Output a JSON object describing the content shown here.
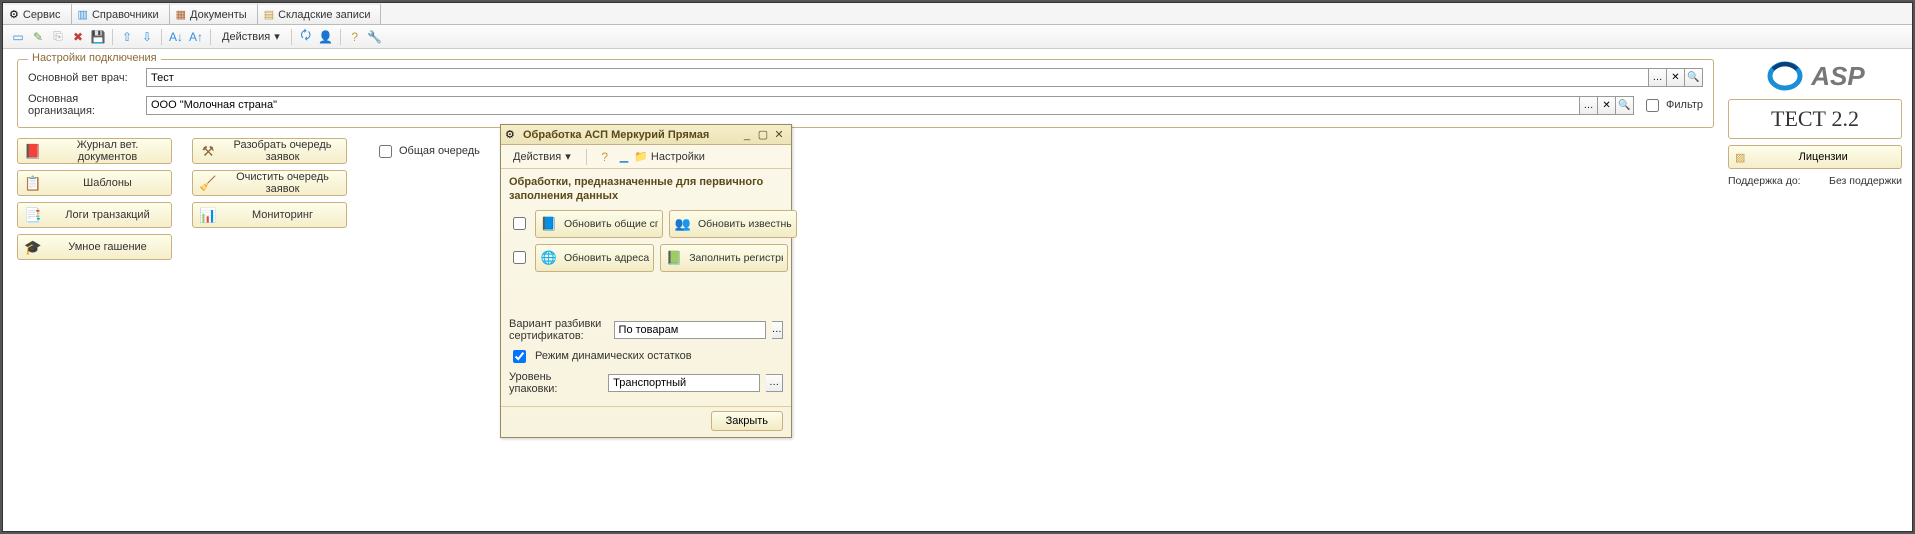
{
  "tabs": [
    {
      "label": "Сервис"
    },
    {
      "label": "Справочники"
    },
    {
      "label": "Документы"
    },
    {
      "label": "Складские записи"
    }
  ],
  "toolbar": {
    "actions": "Действия"
  },
  "connection": {
    "legend": "Настройки подключения",
    "vet_label": "Основной вет врач:",
    "vet_value": "Тест",
    "org_label": "Основная организация:",
    "org_value": "ООО \"Молочная страна\"",
    "filter_label": "Фильтр"
  },
  "buttons": {
    "journal": "Журнал вет. документов",
    "parse_queue": "Разобрать очередь заявок",
    "common_queue": "Общая очередь",
    "templates": "Шаблоны",
    "clear_queue": "Очистить очередь заявок",
    "trans_logs": "Логи транзакций",
    "monitoring": "Мониторинг",
    "smart_clear": "Умное гашение"
  },
  "dialog": {
    "title": "Обработка  АСП Меркурий Прямая",
    "actions": "Действия",
    "settings": "Настройки",
    "heading": "Обработки, предназначенные для первичного заполнения данных",
    "update_common": "Обновить общие справ...",
    "update_known": "Обновить известные хоз.",
    "update_addr": "Обновить адреса",
    "fill_reg": "Заполнить регистры",
    "cert_split_label": "Вариант разбивки сертификатов:",
    "cert_split_value": "По товарам",
    "dyn_remain_label": "Режим динамических остатков",
    "pack_level_label": "Уровень упаковки:",
    "pack_level_value": "Транспортный",
    "close": "Закрыть"
  },
  "right": {
    "brand": "ASP",
    "test": "ТЕСТ 2.2",
    "licenses": "Лицензии",
    "support_label": "Поддержка до:",
    "support_value": "Без поддержки"
  }
}
